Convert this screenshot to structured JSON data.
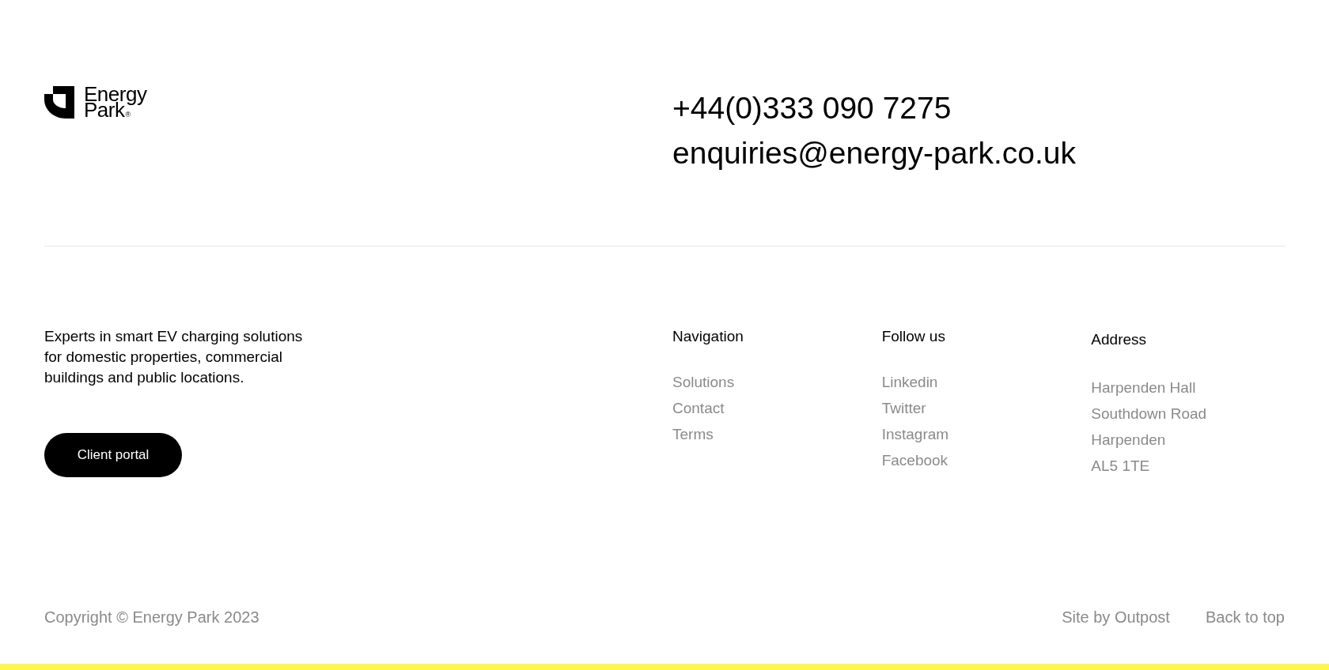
{
  "logo": {
    "name_lines": [
      "Energy",
      "Park"
    ],
    "mark": "®"
  },
  "contact": {
    "phone": "+44(0)333 090 7275",
    "email": "enquiries@energy-park.co.uk"
  },
  "about": {
    "description": "Experts in smart EV charging solutions for domestic properties, commercial buildings and public locations.",
    "button": "Client portal"
  },
  "columns": [
    {
      "kind": "links",
      "heading": "Navigation",
      "items": [
        "Solutions",
        "Contact",
        "Terms"
      ]
    },
    {
      "kind": "links",
      "heading": "Follow us",
      "items": [
        "Linkedin",
        "Twitter",
        "Instagram",
        "Facebook"
      ]
    },
    {
      "kind": "address",
      "heading": "Address",
      "items": [
        "Harpenden Hall",
        "Southdown Road",
        "Harpenden",
        "AL5 1TE"
      ]
    }
  ],
  "bottom_bar": {
    "copyright": "Copyright © Energy Park 2023",
    "links": [
      "Site by Outpost",
      "Back to top"
    ]
  }
}
